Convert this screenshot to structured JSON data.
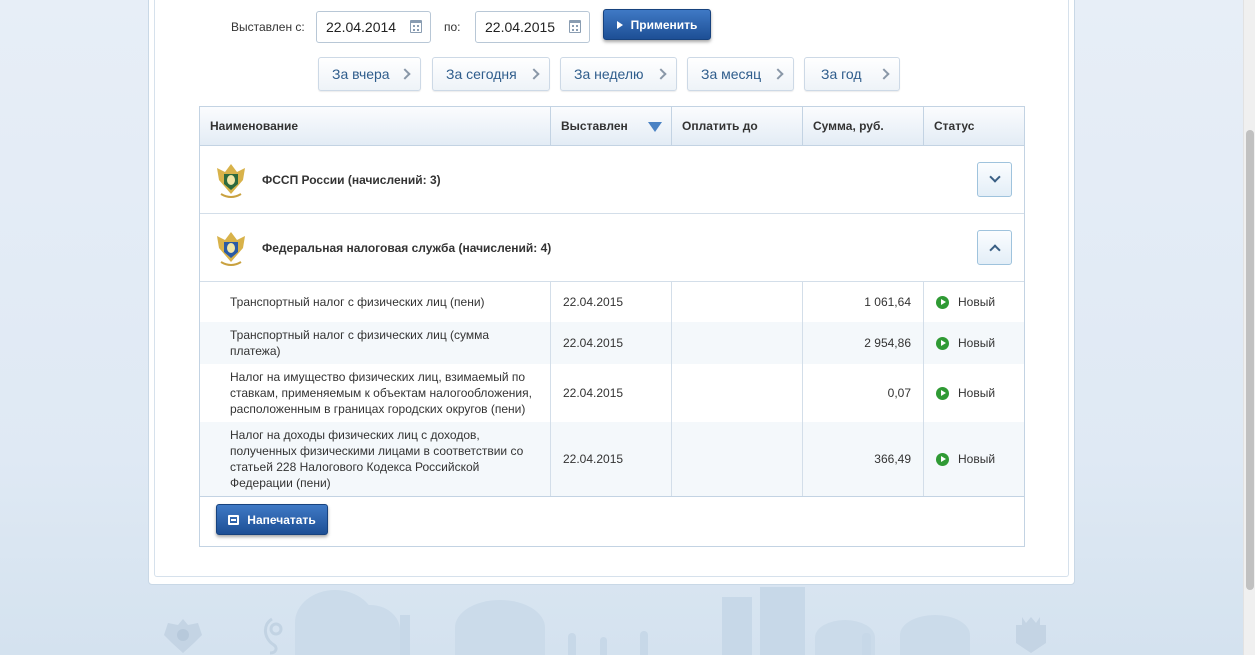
{
  "filter": {
    "from_label": "Выставлен с:",
    "from_value": "22.04.2014",
    "to_label": "по:",
    "to_value": "22.04.2015",
    "apply_label": "Применить"
  },
  "periods": [
    {
      "label": "За вчера"
    },
    {
      "label": "За сегодня"
    },
    {
      "label": "За неделю"
    },
    {
      "label": "За месяц"
    },
    {
      "label": "За год"
    }
  ],
  "table": {
    "headers": {
      "name": "Наименование",
      "issued": "Выставлен",
      "pay_until": "Оплатить до",
      "amount": "Сумма, руб.",
      "status": "Статус"
    },
    "groups": [
      {
        "title": "ФССП России (начислений: 3)",
        "expanded": false
      },
      {
        "title": "Федеральная налоговая служба (начислений: 4)",
        "expanded": true
      }
    ],
    "rows": [
      {
        "name": "Транспортный налог с физических лиц (пени)",
        "issued": "22.04.2015",
        "pay_until": "",
        "amount": "1 061,64",
        "status": "Новый"
      },
      {
        "name": "Транспортный налог с физических лиц (сумма платежа)",
        "issued": "22.04.2015",
        "pay_until": "",
        "amount": "2 954,86",
        "status": "Новый"
      },
      {
        "name": "Налог на имущество физических лиц, взимаемый по ставкам, применяемым к объектам налогообложения, расположенным в границах городских округов (пени)",
        "issued": "22.04.2015",
        "pay_until": "",
        "amount": "0,07",
        "status": "Новый"
      },
      {
        "name": "Налог на доходы физических лиц с доходов, полученных физическими лицами в соответствии со статьей 228 Налогового Кодекса Российской Федерации (пени)",
        "issued": "22.04.2015",
        "pay_until": "",
        "amount": "366,49",
        "status": "Новый"
      }
    ]
  },
  "print_label": "Напечатать",
  "colors": {
    "accent_button": "#2a61ad",
    "status_new": "#2f9a34",
    "link": "#2f5d8c"
  },
  "icons": {
    "calendar": "calendar-icon",
    "apply": "play-icon",
    "print": "printer-icon",
    "status": "status-new-icon",
    "emblem": "russian-emblem-icon"
  }
}
